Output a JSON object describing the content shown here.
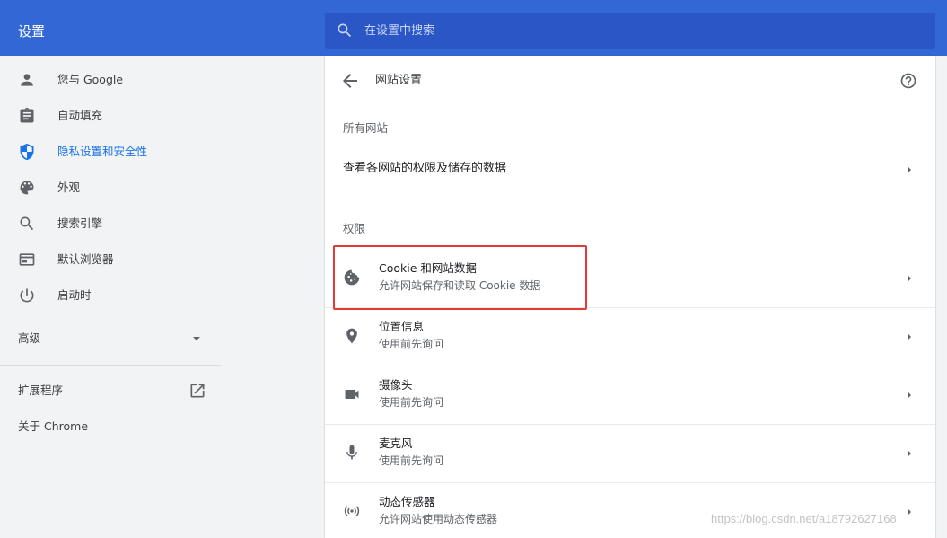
{
  "app": {
    "title": "设置"
  },
  "search": {
    "placeholder": "在设置中搜索"
  },
  "sidebar": {
    "items": [
      {
        "label": "您与 Google",
        "icon": "person-icon"
      },
      {
        "label": "自动填充",
        "icon": "clipboard-icon"
      },
      {
        "label": "隐私设置和安全性",
        "icon": "shield-icon",
        "active": true
      },
      {
        "label": "外观",
        "icon": "palette-icon"
      },
      {
        "label": "搜索引擎",
        "icon": "search-icon"
      },
      {
        "label": "默认浏览器",
        "icon": "browser-window-icon"
      },
      {
        "label": "启动时",
        "icon": "power-icon"
      }
    ],
    "advanced_label": "高级",
    "extensions_label": "扩展程序",
    "about_label": "关于 Chrome"
  },
  "page": {
    "title": "网站设置",
    "all_sites_section": "所有网站",
    "all_sites_row": "查看各网站的权限及储存的数据",
    "permissions_section": "权限",
    "permissions": [
      {
        "title": "Cookie 和网站数据",
        "subtitle": "允许网站保存和读取 Cookie 数据",
        "icon": "cookie-icon"
      },
      {
        "title": "位置信息",
        "subtitle": "使用前先询问",
        "icon": "location-pin-icon"
      },
      {
        "title": "摄像头",
        "subtitle": "使用前先询问",
        "icon": "camera-icon"
      },
      {
        "title": "麦克风",
        "subtitle": "使用前先询问",
        "icon": "microphone-icon"
      },
      {
        "title": "动态传感器",
        "subtitle": "允许网站使用动态传感器",
        "icon": "motion-sensor-icon"
      }
    ]
  },
  "watermark": "https://blog.csdn.net/a18792627168",
  "colors": {
    "topbar": "#3367d6",
    "search": "#2a56c6",
    "accent": "#1a73e8",
    "highlight": "#e53935"
  }
}
